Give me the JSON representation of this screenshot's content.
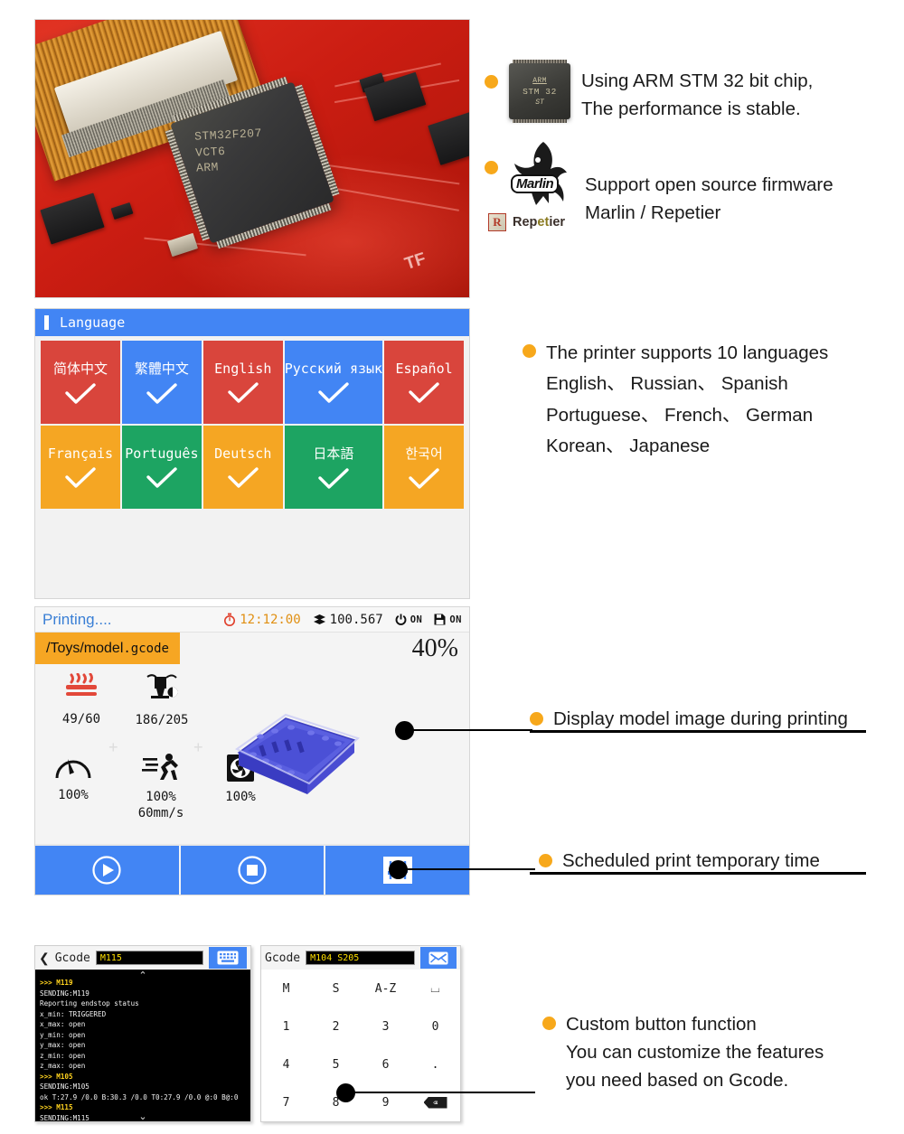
{
  "features": {
    "arm": {
      "bullet_color": "#f7a81b",
      "chip_icon": {
        "arm": "ARM",
        "stm": "STM 32",
        "st": "ST"
      },
      "line1": "Using ARM STM 32 bit chip,",
      "line2": "The performance is stable."
    },
    "marlin": {
      "logo_word": "Marlin",
      "line1": "Support open source firmware",
      "line2": "Marlin / Repetier",
      "repetier_mark": "R",
      "repetier_pre": "Rep",
      "repetier_mid": "et",
      "repetier_post": "ier"
    },
    "languages_note": {
      "line1": "The printer supports 10 languages",
      "line2": "English、 Russian、 Spanish",
      "line3": "Portuguese、 French、 German",
      "line4": "Korean、 Japanese"
    },
    "model_image": "Display model image during printing",
    "scheduled_time": "Scheduled print temporary time",
    "custom_button": {
      "line1": "Custom button function",
      "line2": "You can customize the features",
      "line3": "you need based on Gcode."
    }
  },
  "pcb": {
    "chip_marking_1": "STM32F207",
    "chip_marking_2": "VCT6",
    "chip_marking_3": "ARM",
    "silk_tf": "TF"
  },
  "language_screen": {
    "title": "Language",
    "next_label": "next-arrow",
    "tiles": [
      {
        "label": "简体中文",
        "color": "#d9453c",
        "name": "simplified-chinese"
      },
      {
        "label": "繁體中文",
        "color": "#4285f4",
        "name": "traditional-chinese"
      },
      {
        "label": "English",
        "color": "#d9453c",
        "name": "english"
      },
      {
        "label": "Русский язык",
        "color": "#4285f4",
        "name": "russian"
      },
      {
        "label": "Español",
        "color": "#d9453c",
        "name": "spanish"
      },
      {
        "label": "Français",
        "color": "#f5a623",
        "name": "french"
      },
      {
        "label": "Português",
        "color": "#1da462",
        "name": "portuguese"
      },
      {
        "label": "Deutsch",
        "color": "#f5a623",
        "name": "german"
      },
      {
        "label": "日本語",
        "color": "#1da462",
        "name": "japanese"
      },
      {
        "label": "한국어",
        "color": "#f5a623",
        "name": "korean"
      }
    ]
  },
  "printing_screen": {
    "status": "Printing....",
    "elapsed_time": "12:12:00",
    "layer_height": "100.567",
    "power_state": "ON",
    "storage_state": "ON",
    "file_path": "/Toys/model",
    "file_ext": ".gcode",
    "progress": "40%",
    "stats": {
      "bed": {
        "icon": "heatbed-icon",
        "value": "49/60"
      },
      "nozzle": {
        "icon": "nozzle-icon",
        "value": "186/205"
      },
      "flow": {
        "icon": "gauge-icon",
        "value": "100%"
      },
      "speed": {
        "icon": "runner-icon",
        "value": "100%",
        "value2": "60mm/s"
      },
      "fan": {
        "icon": "fan-icon",
        "value": "100%"
      }
    },
    "controls": [
      {
        "name": "play-pause-button",
        "icon": "play-icon"
      },
      {
        "name": "stop-button",
        "icon": "stop-icon"
      },
      {
        "name": "settings-sliders-button",
        "icon": "sliders-icon"
      }
    ]
  },
  "gcode_terminal": {
    "back_label": "Gcode",
    "input_value": "M115",
    "keyboard_button": "keyboard-icon",
    "console_lines": [
      {
        "text": ">>> M119",
        "cmd": true
      },
      {
        "text": "SENDING:M119",
        "cmd": false
      },
      {
        "text": "Reporting endstop status",
        "cmd": false
      },
      {
        "text": "x_min: TRIGGERED",
        "cmd": false
      },
      {
        "text": "x_max: open",
        "cmd": false
      },
      {
        "text": "y_min: open",
        "cmd": false
      },
      {
        "text": "y_max: open",
        "cmd": false
      },
      {
        "text": "z_min: open",
        "cmd": false
      },
      {
        "text": "z_max: open",
        "cmd": false
      },
      {
        "text": ">>> M105",
        "cmd": true
      },
      {
        "text": "SENDING:M105",
        "cmd": false
      },
      {
        "text": "ok T:27.9 /0.0 B:30.3 /0.0 T0:27.9 /0.0 @:0 B@:0",
        "cmd": false
      },
      {
        "text": ">>> M115",
        "cmd": true
      },
      {
        "text": "SENDING:M115",
        "cmd": false
      }
    ],
    "scroll_up": "⌃",
    "scroll_down": "⌄"
  },
  "gcode_keypad": {
    "title": "Gcode",
    "input_value": "M104 S205",
    "send_button": "send-icon",
    "keys": [
      "M",
      "S",
      "A-Z",
      "⌴",
      "1",
      "2",
      "3",
      "0",
      "4",
      "5",
      "6",
      ".",
      "7",
      "8",
      "9",
      "⌫"
    ]
  },
  "colors": {
    "blue": "#4285f4",
    "orange": "#f6a623",
    "bullet": "#f7a81b",
    "red": "#d9453c",
    "green": "#1da462"
  }
}
